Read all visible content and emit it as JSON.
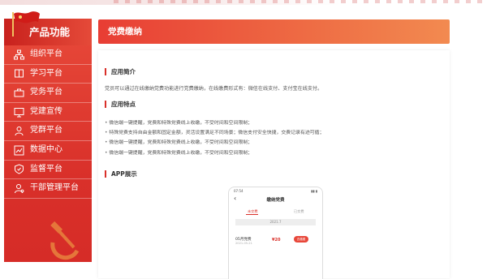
{
  "sidebar": {
    "title": "产品功能",
    "items": [
      {
        "label": "组织平台",
        "icon": "org-chart-icon"
      },
      {
        "label": "学习平台",
        "icon": "book-icon"
      },
      {
        "label": "党务平台",
        "icon": "briefcase-icon"
      },
      {
        "label": "党建宣传",
        "icon": "monitor-icon"
      },
      {
        "label": "党群平台",
        "icon": "group-icon"
      },
      {
        "label": "数据中心",
        "icon": "chart-icon"
      },
      {
        "label": "监督平台",
        "icon": "shield-icon"
      },
      {
        "label": "干部管理平台",
        "icon": "person-icon"
      }
    ]
  },
  "main": {
    "title": "党费缴纳",
    "intro_title": "应用简介",
    "intro_text": "党员可以通过在线缴纳党费功能进行党费缴纳，在线缴费形式有：微信在线支付、支付宝在线支付。",
    "features_title": "应用特点",
    "features": [
      "微信端一键提醒，党费和特殊党费线上收缴，不受时间和空间限制；",
      "特殊党费支持自由金额和固定金额，灵活设置满足不同场景；微信支付安全快捷，交费记录有迹可循；",
      "微信端一键提醒，党费和特殊党费线上收缴，不受时间和空间限制；",
      "微信端一键提醒，党费和特殊党费线上收缴，不受时间和空间限制；"
    ],
    "app_title": "APP展示"
  },
  "phone": {
    "status_time": "07:54",
    "status_icons": "▮▮ ▮",
    "back": "‹",
    "title": "缴纳党费",
    "tab_unpaid": "未交费",
    "tab_paid": "已交费",
    "date": "2021.7",
    "row_title": "05月党费",
    "row_sub": "2021-05-21",
    "amount": "¥20",
    "pay_button": "去缴费"
  },
  "colors": {
    "primary_red": "#d9302a",
    "title_gradient_end": "#f28a50"
  }
}
